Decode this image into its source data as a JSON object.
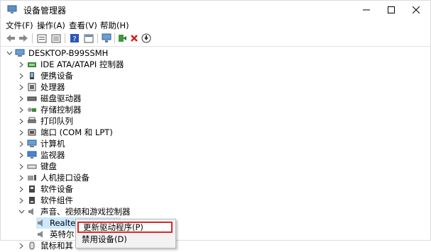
{
  "window": {
    "title": "设备管理器",
    "minimize_glyph": "—",
    "maximize_glyph": "☐",
    "close_glyph": "✕"
  },
  "menu": [
    "文件(F)",
    "操作(A)",
    "查看(V)",
    "帮助(H)"
  ],
  "toolbar": [
    "back-icon",
    "forward-icon",
    "properties-icon",
    "list-icon",
    "help-icon",
    "view-icon",
    "scan-icon",
    "update-driver-icon",
    "uninstall-icon",
    "download-icon"
  ],
  "tree": {
    "root": "DESKTOP-B99SSMH",
    "items": [
      {
        "label": "IDE ATA/ATAPI 控制器",
        "icon": "ide-icon"
      },
      {
        "label": "便携设备",
        "icon": "portable-icon"
      },
      {
        "label": "处理器",
        "icon": "cpu-icon"
      },
      {
        "label": "磁盘驱动器",
        "icon": "disk-icon"
      },
      {
        "label": "存储控制器",
        "icon": "storage-icon"
      },
      {
        "label": "打印队列",
        "icon": "printer-icon"
      },
      {
        "label": "端口 (COM 和 LPT)",
        "icon": "port-icon"
      },
      {
        "label": "计算机",
        "icon": "computer-icon"
      },
      {
        "label": "监视器",
        "icon": "monitor-icon"
      },
      {
        "label": "键盘",
        "icon": "keyboard-icon"
      },
      {
        "label": "人机接口设备",
        "icon": "hid-icon"
      },
      {
        "label": "软件设备",
        "icon": "software-icon"
      },
      {
        "label": "软件组件",
        "icon": "component-icon"
      },
      {
        "label": "声音、视频和游戏控制器",
        "icon": "sound-icon"
      }
    ],
    "sound_children": [
      "Realtek(R) Audio",
      "英特尔"
    ],
    "last_item": "鼠标和其"
  },
  "context_menu": {
    "update_driver": "更新驱动程序(P)",
    "disable_device": "禁用设备(D)"
  },
  "colors": {
    "highlight_border": "#d42a2a",
    "selection": "#cce8ff"
  }
}
